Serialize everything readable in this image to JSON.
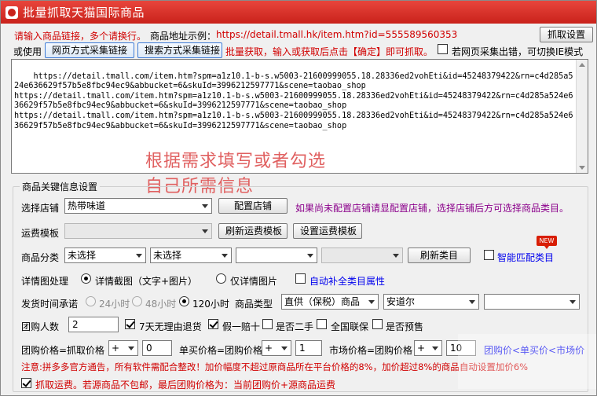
{
  "window": {
    "title": "批量抓取天猫国际商品"
  },
  "header": {
    "prompt_text": "请输入商品链接，多个请换行。",
    "example_label": "商品地址示例：",
    "example_url": "https://detail.tmall.hk/item.htm?id=555589560353",
    "settings_button": "抓取设置",
    "or_use": "或使用",
    "web_collect_button": "网页方式采集链接",
    "search_collect_button": "搜索方式采集链接",
    "batch_hint": "批量获取，输入或获取后点击【确定】即可抓取。",
    "ie_mode_label": "若网页采集出错，可切换IE模式",
    "ie_mode_checked": false
  },
  "links_text": "https://detail.tmall.com/item.htm?spm=a1z10.1-b-s.w5003-21600999055.18.28336ed2vohEti&id=45248379422&rn=c4d285a524e636629f57b5e8fbc94ec9&abbucket=6&skuId=3996212597771&scene=taobao_shop\nhttps://detail.tmall.com/item.htm?spm=a1z10.1-b-s.w5003-21600999055.18.28336ed2vohEti&id=45248379422&rn=c4d285a524e636629f57b5e8fbc94ec9&abbucket=6&skuId=3996212597771&scene=taobao_shop\nhttps://detail.tmall.com/item.htm?spm=a1z10.1-b-s.w5003-21600999055.18.28336ed2vohEti&id=45248379422&rn=c4d285a524e636629f57b5e8fbc94ec9&abbucket=6&skuId=3996212597771&scene=taobao_shop",
  "overlay": {
    "line1": "根据需求填写或者勾选",
    "line2": "自己所需信息"
  },
  "settings": {
    "group_title": "商品关键信息设置",
    "shop_label": "选择店铺",
    "shop_value": "热带味道",
    "config_shop_button": "配置店铺",
    "shop_hint": "如果尚未配置店铺请显配置店铺，选择店铺后方可选择商品类目。",
    "freight_label": "运费模板",
    "freight_value": "",
    "refresh_freight_button": "刷新运费模板",
    "set_freight_button": "设置运费模板",
    "category_label": "商品分类",
    "category_1": "未选择",
    "category_2": "未选择",
    "category_3": "",
    "category_4": "",
    "refresh_category_button": "刷新类目",
    "smart_match_label": "智能匹配类目",
    "new_badge": "NEW",
    "detail_label": "详情图处理",
    "detail_option_1": "详情截图（文字+图片）",
    "detail_option_2": "仅详情图片",
    "auto_fill_label": "自动补全类目属性",
    "ship_label": "发货时间承诺",
    "ship_24": "24小时",
    "ship_48": "48小时",
    "ship_120": "120小时",
    "goods_type_label": "商品类型",
    "goods_type_value": "直供（保税）商品",
    "warehouse_value": "安道尔",
    "extra_value": "",
    "group_size_label": "团购人数",
    "group_size_value": "2",
    "return_7days": "7天无理由退货",
    "fake_one_pay_ten": "假一赔十",
    "second_hand": "是否二手",
    "national_warranty": "全国联保",
    "presale": "是否预售",
    "group_price_label": "团购价格=抓取价格",
    "group_price_op": "+",
    "group_price_value": "0",
    "single_price_label": "单买价格=团购价格",
    "single_price_op": "+",
    "single_price_value": "1",
    "market_price_label": "市场价格=团购价格",
    "market_price_op": "+",
    "market_price_value": "10",
    "price_rule": "团购价<单买价<市场价",
    "notice": "注意:拼多多官方通告，所有软件需配合整改！加价幅度不超过原商品所在平台价格的8%，加价超过8%的商品自动设置加价6%",
    "freight_grab_label": "抓取运费。若源商品不包邮，最后团购价格为：当前团购价+源商品运费"
  },
  "colors": {
    "title_red": "#c9221b",
    "warning_red": "#d10000",
    "link_blue": "#0000ee",
    "hint_purple": "#8b008b"
  }
}
